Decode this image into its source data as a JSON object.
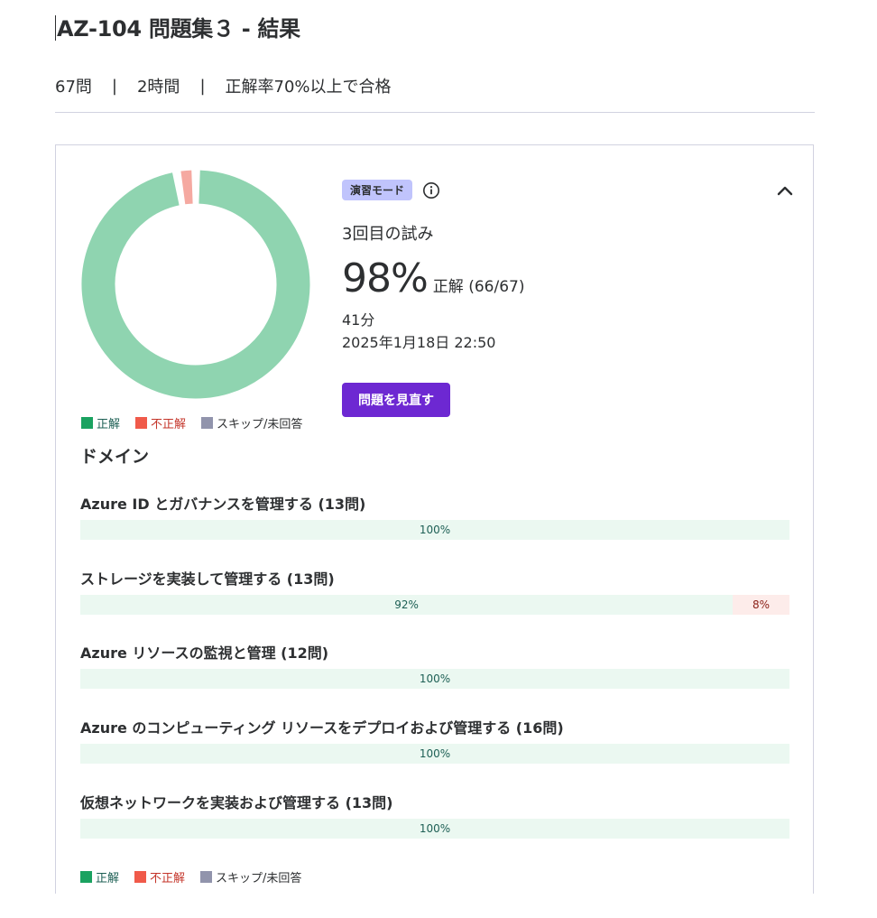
{
  "page": {
    "title": "AZ-104 問題集３ - 結果",
    "meta": {
      "questions": "67問",
      "sep1": "|",
      "duration": "2時間",
      "sep2": "|",
      "pass_rule": "正解率70%以上で合格"
    }
  },
  "colors": {
    "correct": "#8fd4b0",
    "wrong": "#f5a9a1",
    "legend_correct": "#1aa260",
    "legend_wrong": "#f05a4a",
    "legend_skip": "#9194ac",
    "accent": "#6d28d2",
    "badge": "#c0c4fc"
  },
  "result": {
    "mode_badge": "演習モード",
    "info_icon": "info-circle-icon",
    "collapse_icon": "chevron-up-icon",
    "attempt": "3回目の試み",
    "score_percent": "98%",
    "score_label": "正解 (66/67)",
    "correct_count": 66,
    "wrong_count": 1,
    "skipped_count": 0,
    "time_taken": "41分",
    "date": "2025年1月18日 22:50",
    "review_button": "問題を見直す"
  },
  "legend": {
    "correct": "正解",
    "wrong": "不正解",
    "skip": "スキップ/未回答"
  },
  "domains": {
    "heading": "ドメイン",
    "items": [
      {
        "label": "Azure ID とガバナンスを管理する (13問)",
        "correct_pct": 100,
        "correct_text": "100%",
        "wrong_pct": 0,
        "wrong_text": ""
      },
      {
        "label": "ストレージを実装して管理する (13問)",
        "correct_pct": 92,
        "correct_text": "92%",
        "wrong_pct": 8,
        "wrong_text": "8%"
      },
      {
        "label": "Azure リソースの監視と管理 (12問)",
        "correct_pct": 100,
        "correct_text": "100%",
        "wrong_pct": 0,
        "wrong_text": ""
      },
      {
        "label": "Azure のコンピューティング リソースをデプロイおよび管理する (16問)",
        "correct_pct": 100,
        "correct_text": "100%",
        "wrong_pct": 0,
        "wrong_text": ""
      },
      {
        "label": "仮想ネットワークを実装および管理する (13問)",
        "correct_pct": 100,
        "correct_text": "100%",
        "wrong_pct": 0,
        "wrong_text": ""
      }
    ]
  }
}
